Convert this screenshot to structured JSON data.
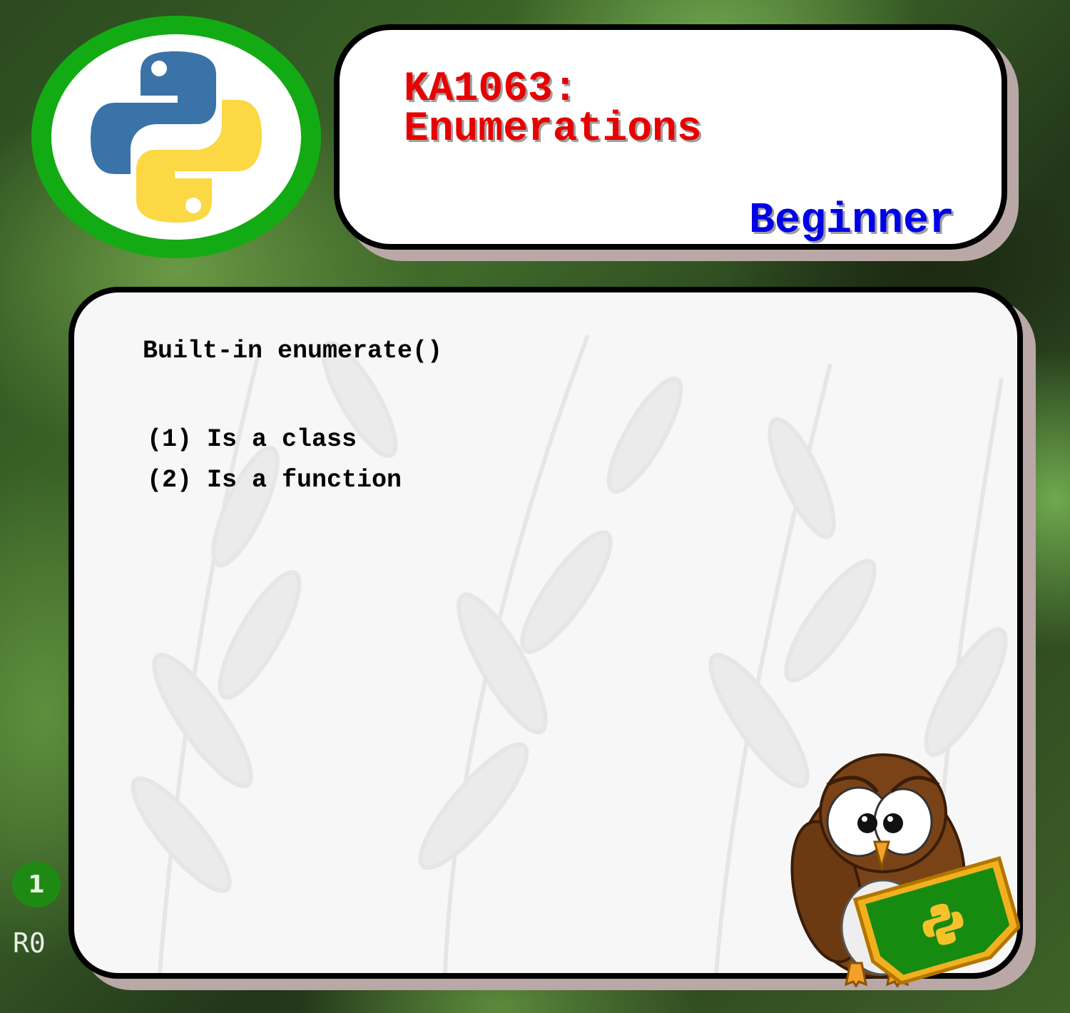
{
  "logo": {
    "name": "python-logo"
  },
  "header": {
    "title_line1": "KA1063:",
    "title_line2": "Enumerations",
    "level": "Beginner"
  },
  "question": {
    "text": "Built-in enumerate()",
    "options": [
      {
        "label": "(1) Is a class"
      },
      {
        "label": "(2) Is a function"
      }
    ]
  },
  "footer": {
    "page_number": "1",
    "revision": "R0"
  },
  "colors": {
    "title": "#e80000",
    "level": "#0000e6",
    "logo_ring": "#13ab13",
    "badge": "#1f8a13"
  }
}
